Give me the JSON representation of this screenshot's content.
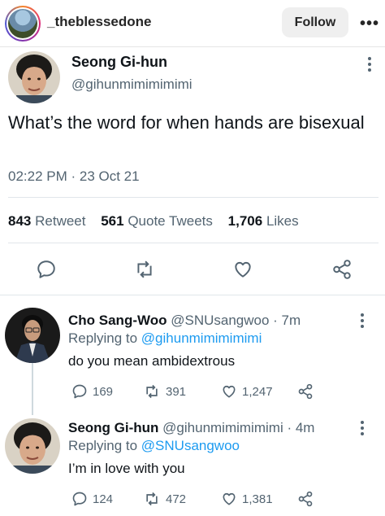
{
  "instagram": {
    "username": "_theblessedone",
    "follow_label": "Follow",
    "more_label": "•••"
  },
  "tweet": {
    "author_name": "Seong Gi-hun",
    "author_handle": "@gihunmimimimimi",
    "text": "What’s the word for when hands are bisexual",
    "timestamp": "02:22 PM · 23 Oct 21",
    "stats": {
      "retweets_count": "843",
      "retweets_label": "Retweet",
      "quotes_count": "561",
      "quotes_label": "Quote Tweets",
      "likes_count": "1,706",
      "likes_label": "Likes"
    },
    "icons": [
      "reply-icon",
      "retweet-icon",
      "like-icon",
      "share-icon",
      "more-icon"
    ]
  },
  "replies": [
    {
      "name": "Cho Sang-Woo",
      "handle": "@SNUsangwoo",
      "time": "· 7m",
      "replying_to_label": "Replying to",
      "replying_to": "@gihunmimimimimi",
      "text": "do you mean ambidextrous",
      "replies": "169",
      "retweets": "391",
      "likes": "1,247"
    },
    {
      "name": "Seong Gi-hun",
      "handle": "@gihunmimimimimi",
      "time": "· 4m",
      "replying_to_label": "Replying to",
      "replying_to": "@SNUsangwoo",
      "text": "I’m in love with you",
      "replies": "124",
      "retweets": "472",
      "likes": "1,381"
    }
  ],
  "colors": {
    "link": "#1d9bf0",
    "secondary_text": "#536471",
    "primary_text": "#0f1419",
    "follow_button_bg": "#efefef"
  }
}
